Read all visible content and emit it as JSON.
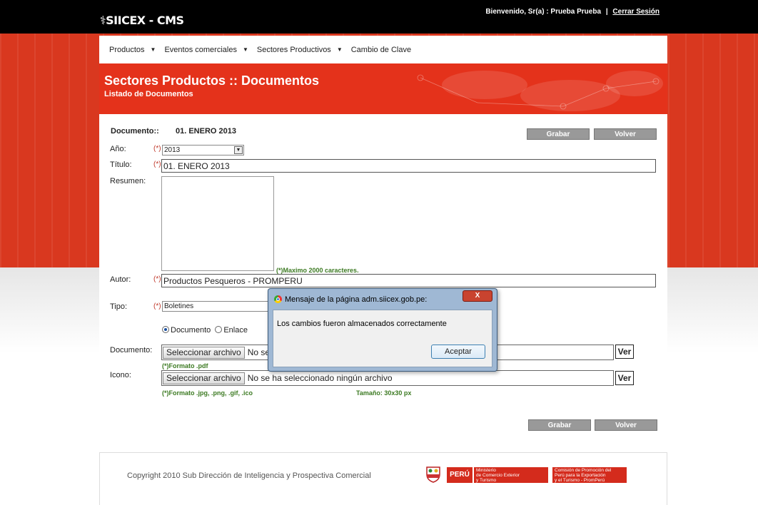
{
  "brand": {
    "logo": "SIICEX - CMS"
  },
  "session": {
    "welcome": "Bienvenido, Sr(a) : Prueba Prueba",
    "separator": "|",
    "logout": "Cerrar Sesión"
  },
  "menu": [
    {
      "label": "Productos"
    },
    {
      "label": "Eventos comerciales"
    },
    {
      "label": "Sectores Productivos"
    },
    {
      "label": "Cambio de Clave"
    }
  ],
  "header": {
    "title": "Sectores Productos :: Documentos",
    "subtitle": "Listado de Documentos"
  },
  "form": {
    "documento_label": "Documento::",
    "documento_value": "01. ENERO 2013",
    "save_label": "Grabar",
    "back_label": "Volver",
    "required_mark": "(*)",
    "anio_label": "Año:",
    "anio_value": "2013",
    "titulo_label": "Título:",
    "titulo_value": "01. ENERO 2013",
    "resumen_label": "Resumen:",
    "resumen_note": "(*)Maximo 2000 caracteres.",
    "autor_label": "Autor:",
    "autor_value": "Productos Pesqueros - PROMPERU",
    "tipo_label": "Tipo:",
    "tipo_value": "Boletines",
    "radio_documento": "Documento",
    "radio_enlace": "Enlace",
    "doc_file_label": "Documento:",
    "file_button": "Seleccionar archivo",
    "doc_file_status": "No se",
    "doc_format_note": "(*)Formato .pdf",
    "icono_label": "Icono:",
    "icono_file_status": "No se ha seleccionado ningún archivo",
    "icono_format_note": "(*)Formato .jpg, .png, .gif, .ico",
    "icono_size_note": "Tamaño: 30x30 px",
    "ver_label": "Ver"
  },
  "dialog": {
    "title": "Mensaje de la página adm.siicex.gob.pe:",
    "close": "X",
    "message": "Los cambios fueron almacenados correctamente",
    "ok": "Aceptar"
  },
  "footer": {
    "copyright": "Copyright 2010 Sub Dirección de Inteligencia y Prospectiva Comercial",
    "peru": "PERÚ",
    "ministerio_lines": [
      "Ministerio",
      "de Comercio Exterior",
      "y Turismo"
    ],
    "promperu_lines": [
      "Comisión de Promoción del",
      "Perú para la Exportación",
      "y el Turismo - PromPerú"
    ]
  },
  "colors": {
    "brand_orange": "#e4321b",
    "topbar": "#000000",
    "note_green": "#3c7a22",
    "required_red": "#c0392b"
  }
}
